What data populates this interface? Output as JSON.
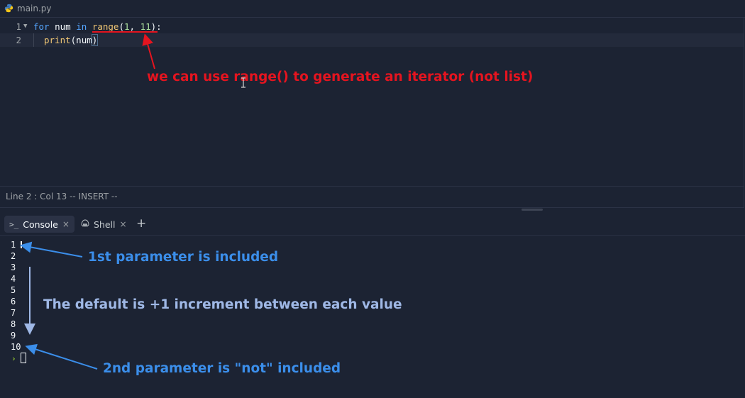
{
  "editor": {
    "file_tab": {
      "name": "main.py",
      "icon": "python-icon"
    },
    "lines": [
      {
        "number": "1",
        "fold": "▼"
      },
      {
        "number": "2"
      }
    ],
    "code": {
      "line1": {
        "kw_for": "for",
        "var": "num",
        "kw_in": "in",
        "fn": "range",
        "open": "(",
        "arg1": "1",
        "comma": ", ",
        "arg2": "11",
        "close": "):"
      },
      "line2": {
        "fn": "print",
        "open": "(",
        "arg": "num",
        "close": ")"
      }
    },
    "status": "Line 2 : Col 13  -- INSERT --"
  },
  "console": {
    "tabs": [
      {
        "label": "Console",
        "icon": "terminal-icon",
        "active": true
      },
      {
        "label": "Shell",
        "icon": "shell-icon",
        "active": false
      }
    ],
    "close_glyph": "×",
    "add_glyph": "+",
    "output": [
      "1",
      "2",
      "3",
      "4",
      "5",
      "6",
      "7",
      "8",
      "9",
      "10"
    ],
    "prompt_glyph": "›"
  },
  "annotations": {
    "range_note": "we can use range() to generate an iterator (not list)",
    "first_param": "1st parameter is included",
    "increment": "The default is +1 increment between each value",
    "second_param": "2nd parameter is \"not\" included"
  },
  "colors": {
    "background": "#1c2333",
    "keyword": "#55a5fe",
    "function": "#f0c674",
    "number": "#aee1a0",
    "annotation_red": "#e5141f",
    "annotation_blue": "#3b8eea"
  }
}
